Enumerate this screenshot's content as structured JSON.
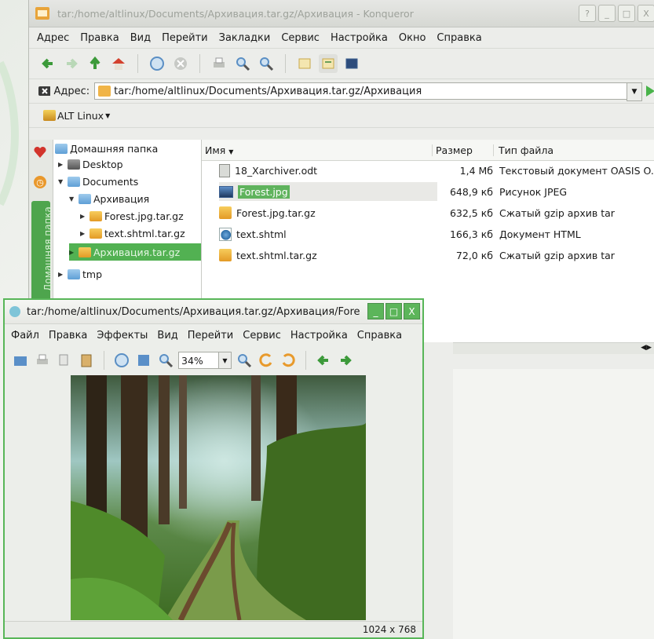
{
  "konqueror": {
    "title": "tar:/home/altlinux/Documents/Архивация.tar.gz/Архивация - Konqueror",
    "window_buttons": [
      "?",
      "_",
      "□",
      "X"
    ],
    "menu": [
      "Адрес",
      "Правка",
      "Вид",
      "Перейти",
      "Закладки",
      "Сервис",
      "Настройка",
      "Окно",
      "Справка"
    ],
    "address_label": "Адрес:",
    "address_value": "tar:/home/altlinux/Documents/Архивация.tar.gz/Архивация",
    "bookmark": "ALT Linux",
    "side_tab_label": "Домашняя папка",
    "tree": [
      {
        "label": "Домашняя папка"
      },
      {
        "label": "Desktop"
      },
      {
        "label": "Documents"
      },
      {
        "label": "Архивация"
      },
      {
        "label": "Forest.jpg.tar.gz"
      },
      {
        "label": "text.shtml.tar.gz"
      },
      {
        "label": "Архивация.tar.gz"
      },
      {
        "label": "tmp"
      }
    ],
    "columns": {
      "name": "Имя",
      "size": "Размер",
      "type": "Тип файла"
    },
    "files": [
      {
        "name": "18_Xarchiver.odt",
        "size": "1,4 Мб",
        "type": "Текстовый документ OASIS O..."
      },
      {
        "name": "Forest.jpg",
        "size": "648,9 кб",
        "type": "Рисунок JPEG"
      },
      {
        "name": "Forest.jpg.tar.gz",
        "size": "632,5 кб",
        "type": "Сжатый gzip архив tar"
      },
      {
        "name": "text.shtml",
        "size": "166,3 кб",
        "type": "Документ HTML"
      },
      {
        "name": "text.shtml.tar.gz",
        "size": "72,0 кб",
        "type": "Сжатый gzip архив tar"
      }
    ]
  },
  "viewer": {
    "title": "tar:/home/altlinux/Documents/Архивация.tar.gz/Архивация/Fore",
    "window_buttons": [
      "_",
      "□",
      "X"
    ],
    "menu": [
      "Файл",
      "Правка",
      "Эффекты",
      "Вид",
      "Перейти",
      "Сервис",
      "Настройка",
      "Справка"
    ],
    "zoom": "34%",
    "image_size": "1024 x 768"
  },
  "colors": {
    "accent": "#52b152",
    "folder": "#5f9fd6",
    "archive": "#e39a26"
  }
}
